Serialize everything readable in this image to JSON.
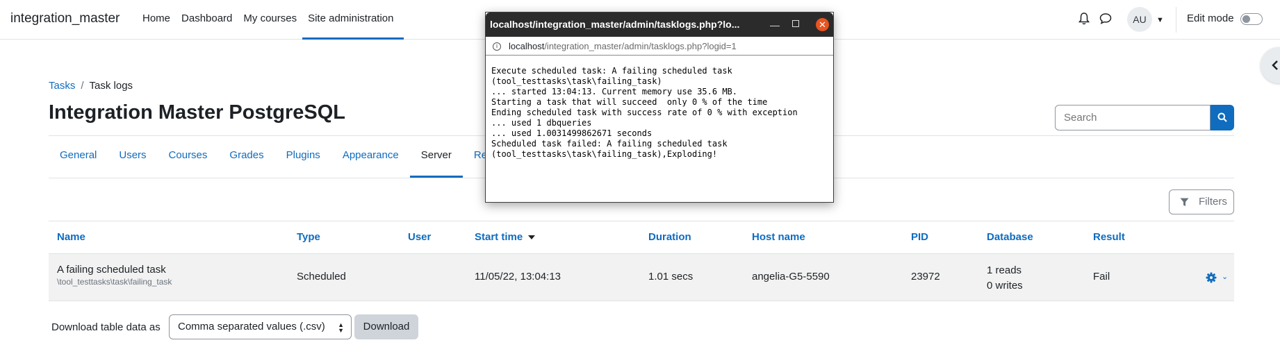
{
  "navbar": {
    "brand": "integration_master",
    "items": [
      {
        "label": "Home"
      },
      {
        "label": "Dashboard"
      },
      {
        "label": "My courses"
      },
      {
        "label": "Site administration"
      }
    ],
    "avatar_initials": "AU",
    "edit_mode_label": "Edit mode"
  },
  "breadcrumb": {
    "items": [
      {
        "label": "Tasks"
      },
      {
        "label": "Task logs"
      }
    ],
    "separator": "/"
  },
  "page_title": "Integration Master PostgreSQL",
  "search": {
    "placeholder": "Search"
  },
  "tabs": [
    {
      "label": "General"
    },
    {
      "label": "Users"
    },
    {
      "label": "Courses"
    },
    {
      "label": "Grades"
    },
    {
      "label": "Plugins"
    },
    {
      "label": "Appearance"
    },
    {
      "label": "Server"
    },
    {
      "label": "Re"
    }
  ],
  "filters_label": "Filters",
  "table": {
    "headers": [
      "Name",
      "Type",
      "User",
      "Start time",
      "Duration",
      "Host name",
      "PID",
      "Database",
      "Result"
    ],
    "rows": [
      {
        "name": "A failing scheduled task",
        "classname": "\\tool_testtasks\\task\\failing_task",
        "type": "Scheduled",
        "user": "",
        "start_time": "11/05/22, 13:04:13",
        "duration": "1.01 secs",
        "host": "angelia-G5-5590",
        "pid": "23972",
        "db_reads": "1 reads",
        "db_writes": "0 writes",
        "result": "Fail"
      }
    ]
  },
  "download": {
    "label": "Download table data as",
    "format": "Comma separated values (.csv)",
    "button": "Download"
  },
  "popup": {
    "title": "localhost/integration_master/admin/tasklogs.php?lo...",
    "url_host": "localhost",
    "url_path": "/integration_master/admin/tasklogs.php?logid=1",
    "log": "Execute scheduled task: A failing scheduled task\n(tool_testtasks\\task\\failing_task)\n... started 13:04:13. Current memory use 35.6 MB.\nStarting a task that will succeed  only 0 % of the time\nEnding scheduled task with success rate of 0 % with exception\n... used 1 dbqueries\n... used 1.0031499862671 seconds\nScheduled task failed: A failing scheduled task\n(tool_testtasks\\task\\failing_task),Exploding!"
  }
}
